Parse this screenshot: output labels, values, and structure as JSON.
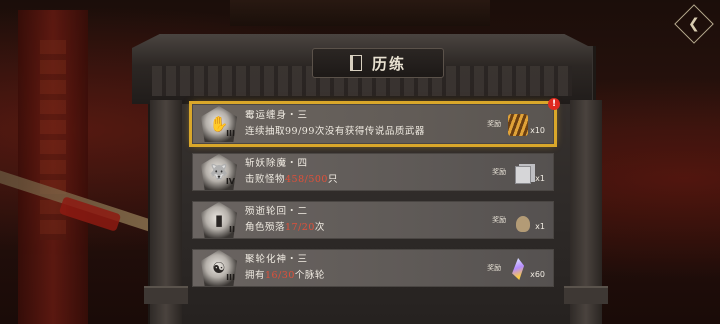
{
  "panel": {
    "title": "历练"
  },
  "tasks": [
    {
      "name": "霉运缠身・三",
      "desc_pre": "连续抽取99/99次没有获得传说品质武器",
      "desc_hl": "",
      "desc_post": "",
      "tier": "III",
      "emblem_icon": "hand-icon",
      "reward_label": "奖励",
      "reward_count": "x10",
      "reward_icon": "arrows-icon",
      "active": true,
      "alert": "!"
    },
    {
      "name": "斩妖除魔・四",
      "desc_pre": "击败怪物",
      "desc_hl": "458/500",
      "desc_post": "只",
      "tier": "IV",
      "emblem_icon": "beast-icon",
      "reward_label": "奖励",
      "reward_count": "x1",
      "reward_icon": "cards-icon",
      "active": false
    },
    {
      "name": "殒逝轮回・二",
      "desc_pre": "角色殒落",
      "desc_hl": "17/20",
      "desc_post": "次",
      "tier": "II",
      "emblem_icon": "tombstone-icon",
      "reward_label": "奖励",
      "reward_count": "x1",
      "reward_icon": "bag-icon",
      "active": false
    },
    {
      "name": "聚轮化神・三",
      "desc_pre": "拥有",
      "desc_hl": "16/30",
      "desc_post": "个脉轮",
      "tier": "III",
      "emblem_icon": "yin-yang-icon",
      "reward_label": "奖励",
      "reward_count": "x60",
      "reward_icon": "crystal-icon",
      "active": false
    }
  ],
  "colors": {
    "highlight": "#e0503a",
    "active_border": "#d9a72a",
    "alert": "#e02a1f"
  }
}
